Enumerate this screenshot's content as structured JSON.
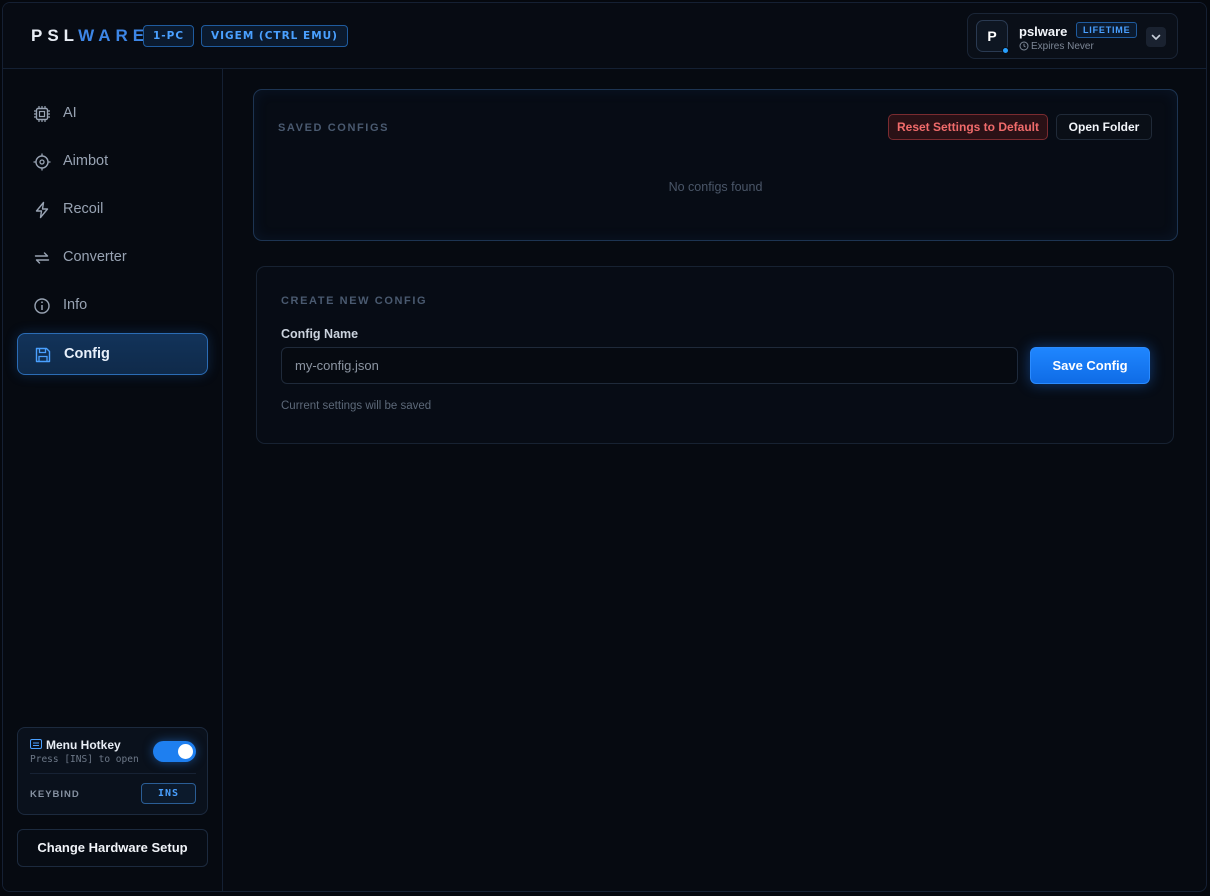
{
  "header": {
    "logo_prefix": "PSL",
    "logo_suffix": "WARE",
    "tags": [
      "1-PC",
      "VIGEM (CTRL EMU)"
    ],
    "user": {
      "avatar_letter": "P",
      "name": "pslware",
      "plan_badge": "LIFETIME",
      "expires": "Expires Never"
    }
  },
  "sidebar": {
    "items": [
      {
        "label": "AI",
        "icon": "cpu-icon"
      },
      {
        "label": "Aimbot",
        "icon": "crosshair-icon"
      },
      {
        "label": "Recoil",
        "icon": "lightning-icon"
      },
      {
        "label": "Converter",
        "icon": "swap-icon"
      },
      {
        "label": "Info",
        "icon": "info-icon"
      },
      {
        "label": "Config",
        "icon": "save-icon",
        "active": true
      }
    ],
    "hotkey": {
      "title": "Menu Hotkey",
      "subtitle": "Press [INS] to open",
      "enabled": true,
      "keybind_label": "KEYBIND",
      "keybind_value": "INS"
    },
    "hardware_button": "Change Hardware Setup"
  },
  "saved_configs": {
    "title": "SAVED CONFIGS",
    "reset_button": "Reset Settings to Default",
    "open_folder_button": "Open Folder",
    "empty_message": "No configs found"
  },
  "create_config": {
    "title": "CREATE NEW CONFIG",
    "field_label": "Config Name",
    "placeholder": "my-config.json",
    "value": "",
    "save_button": "Save Config",
    "hint": "Current settings will be saved"
  },
  "colors": {
    "accent": "#1f86ff",
    "danger": "#f06b6b",
    "background": "#060a11"
  }
}
